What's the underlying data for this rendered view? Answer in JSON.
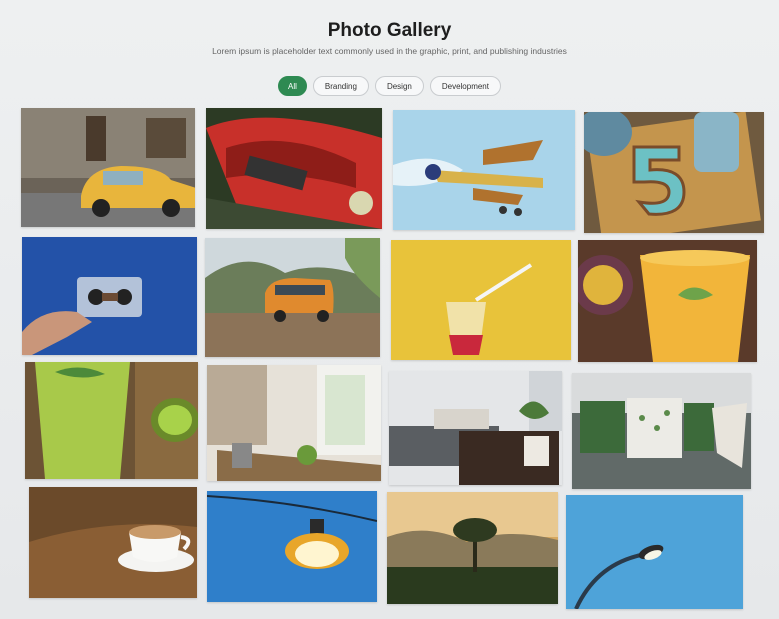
{
  "header": {
    "title": "Photo Gallery",
    "subtitle": "Lorem ipsum is placeholder text commonly used in the graphic, print, and publishing industries"
  },
  "filters": [
    {
      "label": "All",
      "active": true
    },
    {
      "label": "Branding",
      "active": false
    },
    {
      "label": "Design",
      "active": false
    },
    {
      "label": "Development",
      "active": false
    }
  ],
  "colors": {
    "accent": "#2e8a52"
  },
  "gallery": [
    {
      "name": "photo-yellow-vintage-car"
    },
    {
      "name": "photo-red-mustang"
    },
    {
      "name": "photo-biplane"
    },
    {
      "name": "photo-cookie-number-five"
    },
    {
      "name": "photo-cassette-tape"
    },
    {
      "name": "photo-orange-van"
    },
    {
      "name": "photo-drink-with-straw"
    },
    {
      "name": "photo-passion-fruit-juice"
    },
    {
      "name": "photo-kiwi-smoothie"
    },
    {
      "name": "photo-dining-room"
    },
    {
      "name": "photo-living-room-sofa"
    },
    {
      "name": "photo-sofa-with-cushions"
    },
    {
      "name": "photo-coffee-cup"
    },
    {
      "name": "photo-hanging-bulb"
    },
    {
      "name": "photo-tree-sunrise"
    },
    {
      "name": "photo-street-lamp"
    }
  ]
}
